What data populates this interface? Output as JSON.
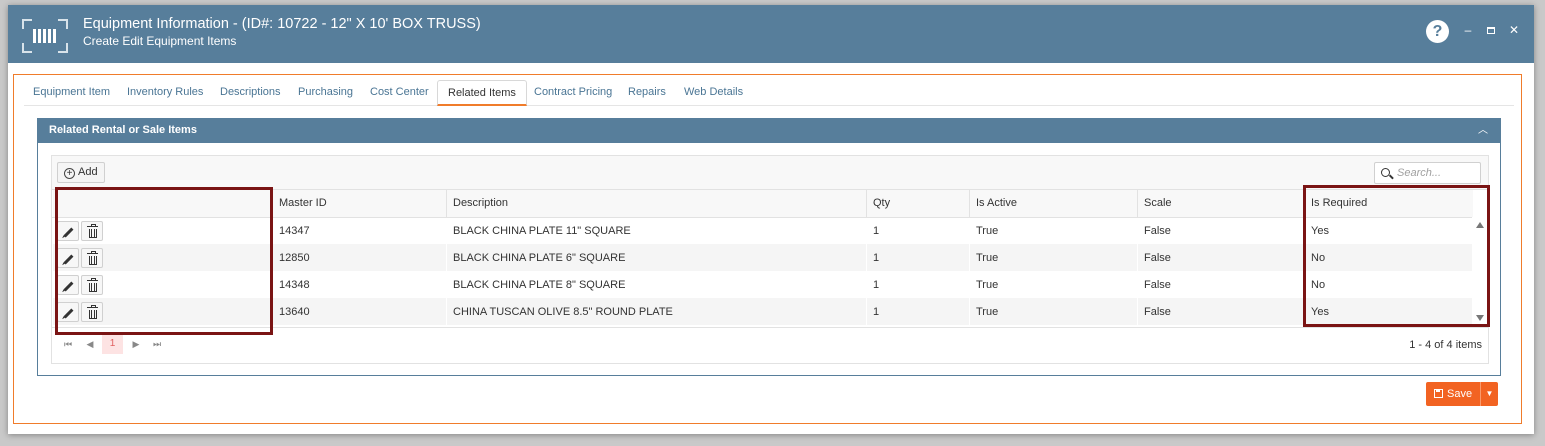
{
  "window": {
    "title": "Equipment Information - (ID#: 10722 - 12\" X 10' BOX TRUSS)",
    "subtitle": "Create Edit Equipment Items",
    "help_label": "?",
    "minimize_label": "–",
    "close_label": "✕"
  },
  "tabs": [
    {
      "label": "Equipment Item"
    },
    {
      "label": "Inventory Rules"
    },
    {
      "label": "Descriptions"
    },
    {
      "label": "Purchasing"
    },
    {
      "label": "Cost Center"
    },
    {
      "label": "Related Items",
      "active": true
    },
    {
      "label": "Contract Pricing"
    },
    {
      "label": "Repairs"
    },
    {
      "label": "Web Details"
    }
  ],
  "section": {
    "title": "Related Rental or Sale Items",
    "collapse_icon": "chevron-up-icon"
  },
  "grid": {
    "add_label": "Add",
    "search_placeholder": "Search...",
    "columns": [
      "",
      "Master ID",
      "Description",
      "Qty",
      "Is Active",
      "Scale",
      "Is Required"
    ],
    "rows": [
      {
        "master_id": "14347",
        "description": "BLACK CHINA PLATE 11\" SQUARE",
        "qty": "1",
        "is_active": "True",
        "scale": "False",
        "is_required": "Yes"
      },
      {
        "master_id": "12850",
        "description": "BLACK CHINA PLATE 6\" SQUARE",
        "qty": "1",
        "is_active": "True",
        "scale": "False",
        "is_required": "No"
      },
      {
        "master_id": "14348",
        "description": "BLACK CHINA PLATE 8\" SQUARE",
        "qty": "1",
        "is_active": "True",
        "scale": "False",
        "is_required": "No"
      },
      {
        "master_id": "13640",
        "description": "CHINA TUSCAN OLIVE 8.5\" ROUND PLATE",
        "qty": "1",
        "is_active": "True",
        "scale": "False",
        "is_required": "Yes"
      }
    ],
    "pager": {
      "first": "⏮",
      "prev": "◀",
      "current_page": "1",
      "next": "▶",
      "last": "⏭",
      "info": "1 - 4 of 4 items"
    }
  },
  "footer": {
    "save_label": "Save",
    "dropdown_label": "▼"
  },
  "colors": {
    "header_blue": "#577e9b",
    "accent_orange": "#f26322",
    "highlight_border": "#7a1414"
  }
}
